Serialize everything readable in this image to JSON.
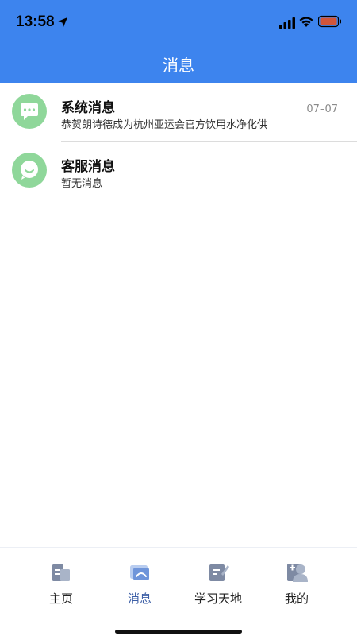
{
  "status_bar": {
    "time": "13:58",
    "icons": [
      "location-arrow-icon",
      "cellular-signal-icon",
      "wifi-icon",
      "battery-icon"
    ]
  },
  "nav": {
    "title": "消息"
  },
  "messages": [
    {
      "title": "系统消息",
      "preview": "恭贺朗诗德成为杭州亚运会官方饮用水净化供",
      "date": "07–07",
      "icon": "chat-bubble-dots-icon"
    },
    {
      "title": "客服消息",
      "preview": "暂无消息",
      "date": "",
      "icon": "chat-bubble-smile-icon"
    }
  ],
  "tabs": [
    {
      "label": "主页",
      "icon": "home-building-icon",
      "active": false
    },
    {
      "label": "消息",
      "icon": "message-icon",
      "active": true
    },
    {
      "label": "学习天地",
      "icon": "study-notes-icon",
      "active": false
    },
    {
      "label": "我的",
      "icon": "profile-icon",
      "active": false
    }
  ],
  "colors": {
    "header": "#3d84ee",
    "avatar_green": "#8fd79a",
    "tab_icon": "#7e8aa3",
    "tab_active": "#3d5fa6"
  }
}
